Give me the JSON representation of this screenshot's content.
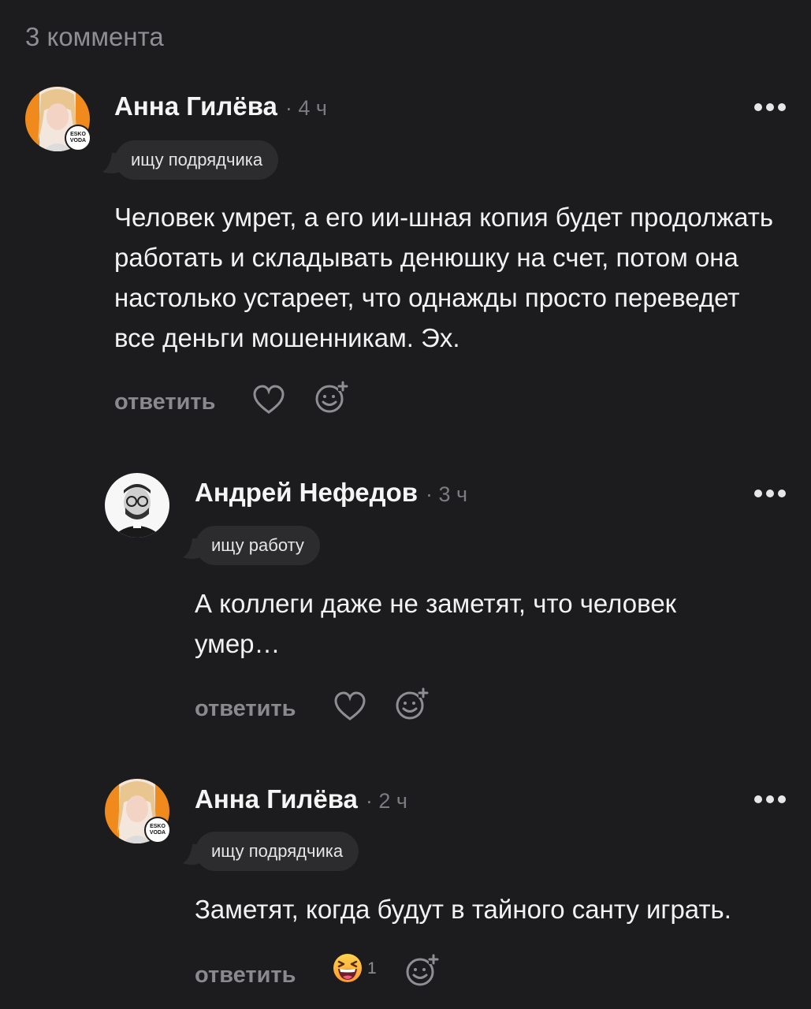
{
  "header": {
    "count_label": "3 коммента"
  },
  "comments": [
    {
      "author": "Анна Гилёва",
      "time": "· 4 ч",
      "tag": "ищу подрядчика",
      "text": "Человек умрет, а его ии-шная копия будет продолжать работать и складывать денюшку на счет, потом она настолько устареет, что однажды просто переведет все деньги мошенникам. Эх.",
      "reply_label": "ответить",
      "avatar_badge": "ESKO VODA"
    },
    {
      "author": "Андрей Нефедов",
      "time": "· 3 ч",
      "tag": "ищу работу",
      "text": "А коллеги даже не заметят, что человек умер…",
      "reply_label": "ответить"
    },
    {
      "author": "Анна Гилёва",
      "time": "· 2 ч",
      "tag": "ищу подрядчика",
      "text": "Заметят, когда будут в тайного санту играть.",
      "reply_label": "ответить",
      "avatar_badge": "ESKO VODA",
      "reaction": {
        "emoji": "grinning-squint-face",
        "count": "1"
      }
    }
  ],
  "colors": {
    "background": "#1c1c1e",
    "tag_bg": "#2c2c2e",
    "muted": "#8a8a8e",
    "avatar_orange": "#f08a1c"
  }
}
